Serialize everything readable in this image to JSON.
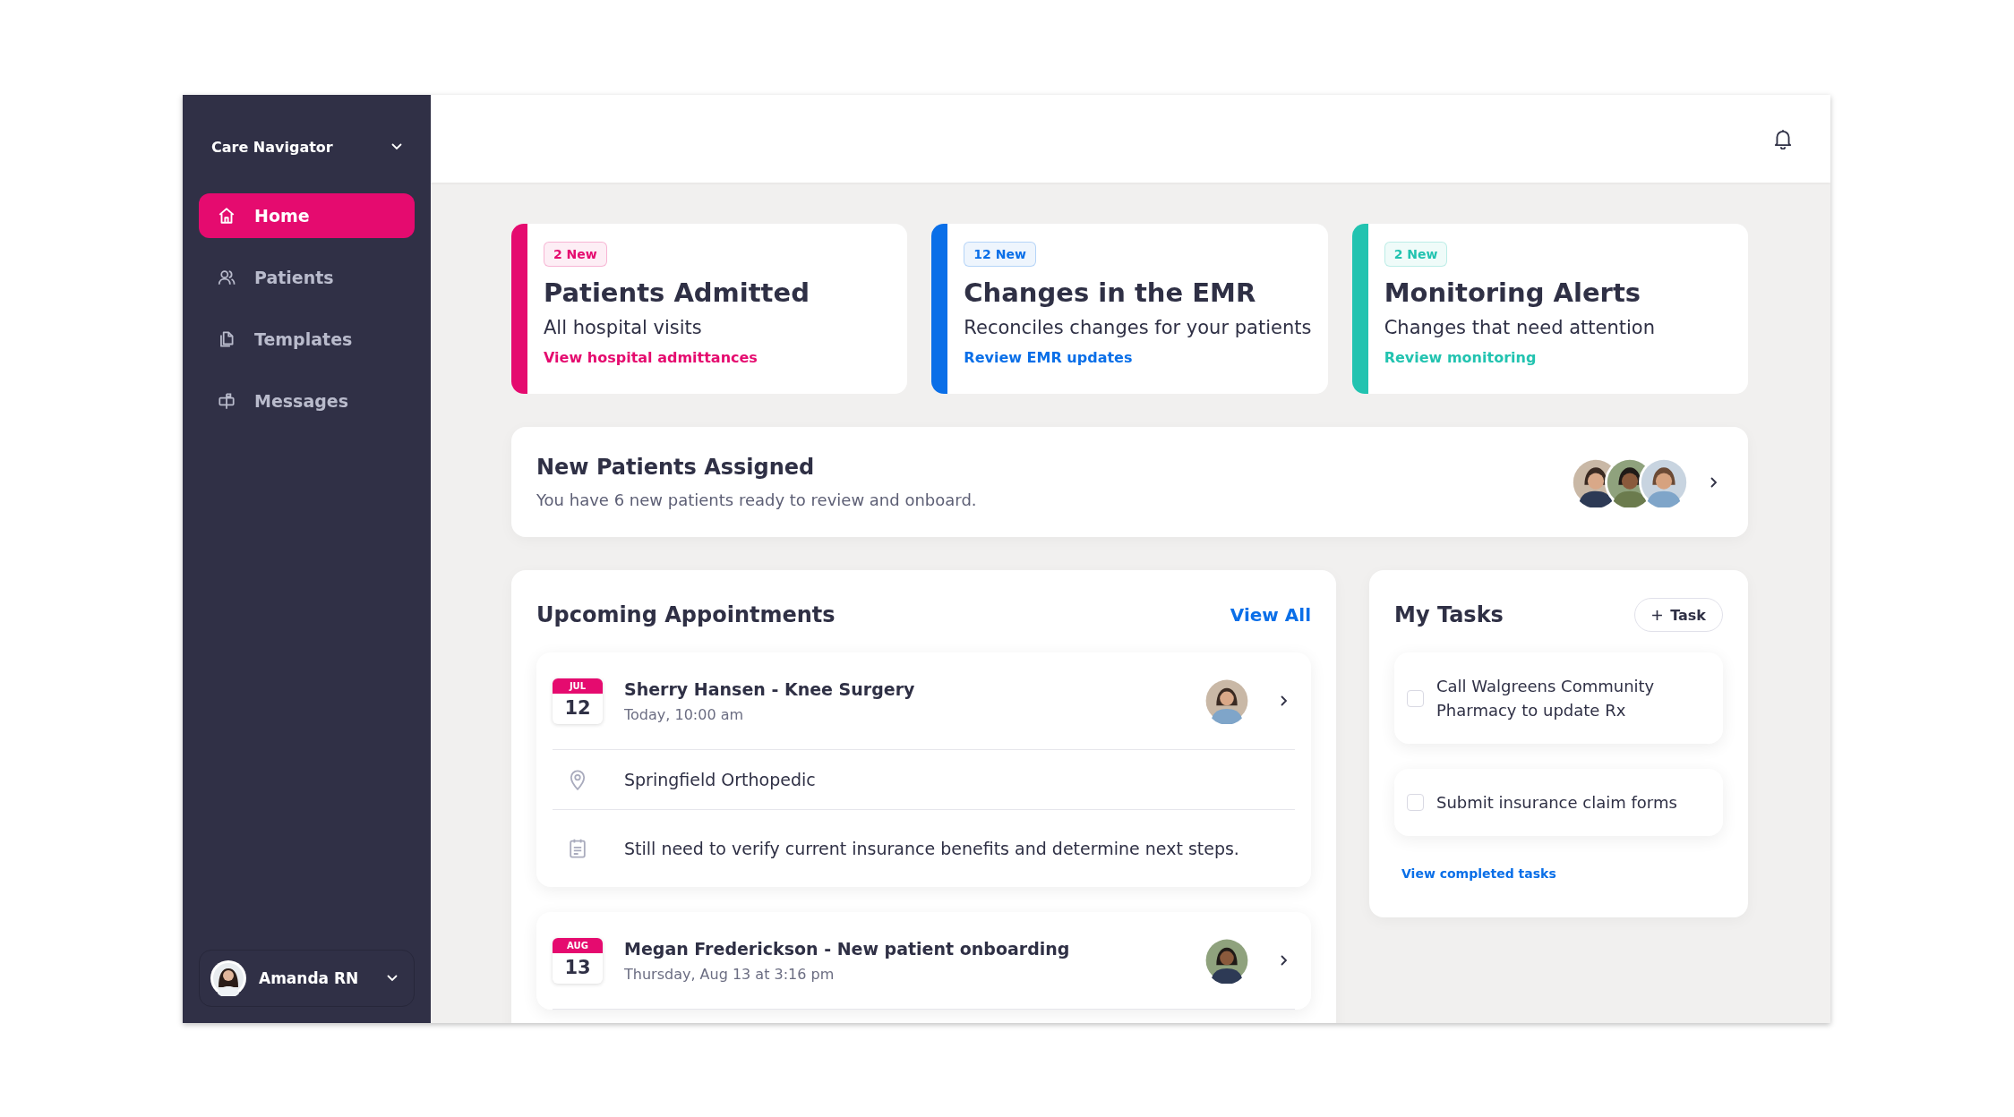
{
  "sidebar": {
    "workspace": "Care Navigator",
    "items": [
      {
        "label": "Home",
        "kind": "home",
        "selected": true
      },
      {
        "label": "Patients",
        "kind": "people",
        "selected": false
      },
      {
        "label": "Templates",
        "kind": "pages",
        "selected": false
      },
      {
        "label": "Messages",
        "kind": "mailbox",
        "selected": false
      }
    ],
    "user": {
      "name": "Amanda RN"
    }
  },
  "summary_cards": [
    {
      "badge": "2 New",
      "title": "Patients Admitted",
      "subtitle": "All hospital visits",
      "link": "View hospital admittances",
      "color": "#e50b6f"
    },
    {
      "badge": "12 New",
      "title": "Changes in the EMR",
      "subtitle": "Reconciles changes for your patients",
      "link": "Review EMR updates",
      "color": "#0a6fe8"
    },
    {
      "badge": "2 New",
      "title": "Monitoring Alerts",
      "subtitle": "Changes that need attention",
      "link": "Review monitoring",
      "color": "#22c3b0"
    }
  ],
  "new_patients": {
    "title": "New Patients Assigned",
    "text": "You have 6 new patients ready to review and onboard."
  },
  "appointments": {
    "title": "Upcoming Appointments",
    "view_all": "View All",
    "items": [
      {
        "month": "JUL",
        "day": "12",
        "title": "Sherry Hansen - Knee Surgery",
        "time": "Today, 10:00 am",
        "details": [
          {
            "kind": "location",
            "text": "Springfield Orthopedic"
          },
          {
            "kind": "note",
            "text": "Still need to verify current insurance benefits and determine next steps."
          }
        ]
      },
      {
        "month": "AUG",
        "day": "13",
        "title": "Megan Frederickson - New patient onboarding",
        "time": "Thursday, Aug 13 at 3:16 pm"
      }
    ]
  },
  "tasks": {
    "title": "My Tasks",
    "add_button": "Task",
    "items": [
      {
        "text": "Call Walgreens Community Pharmacy to update Rx",
        "checked": false
      },
      {
        "text": "Submit insurance claim forms",
        "checked": false
      }
    ],
    "footer_link": "View completed tasks"
  }
}
